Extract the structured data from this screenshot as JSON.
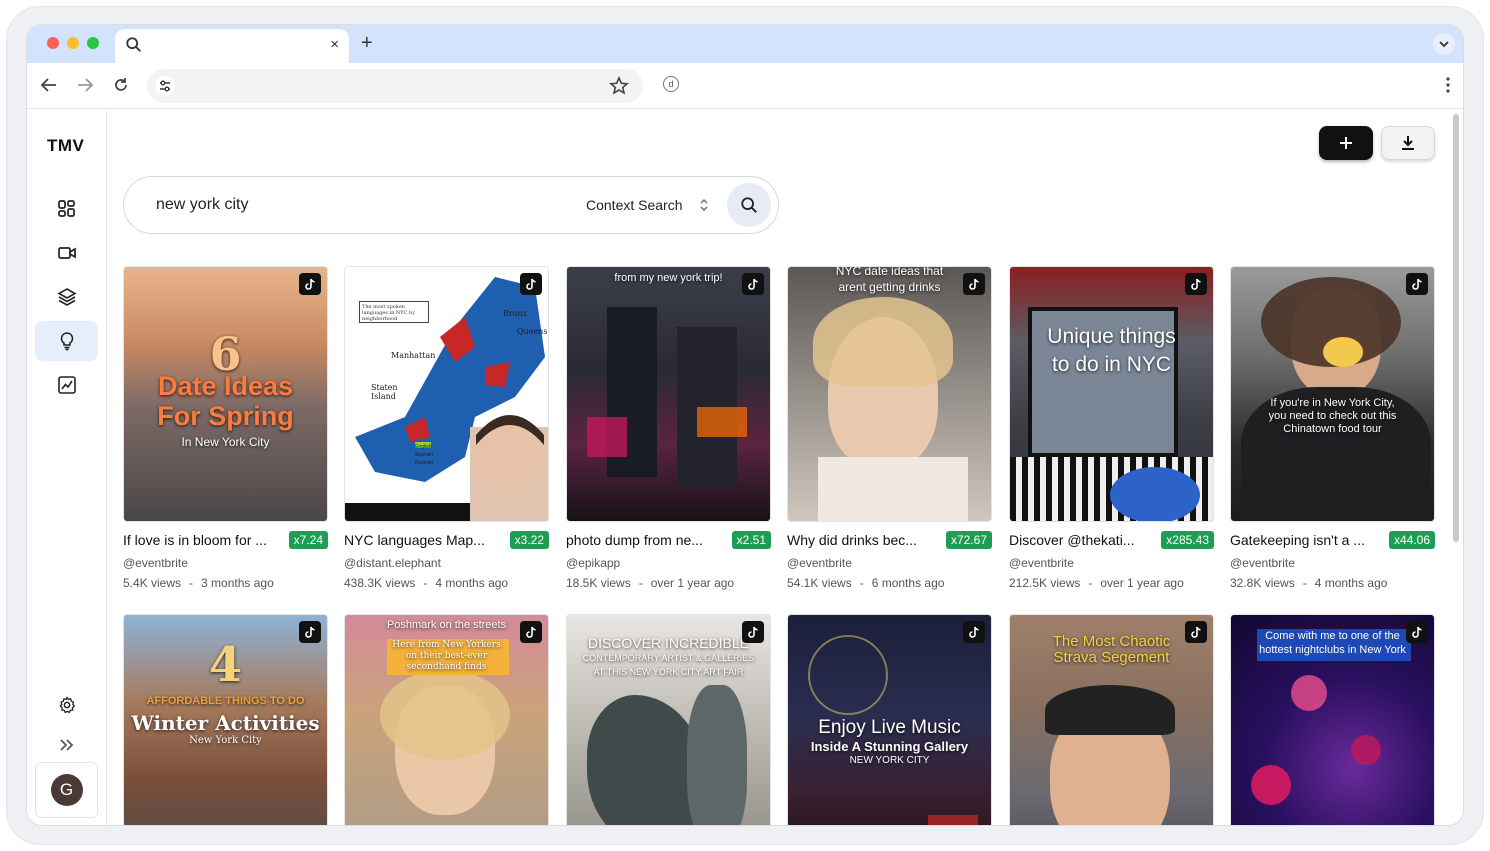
{
  "browser": {
    "tab_close": "×",
    "new_tab": "+",
    "extension_label": "d"
  },
  "app": {
    "logo": "TMV",
    "avatar_initial": "G"
  },
  "search": {
    "query": "new york city",
    "mode": "Context Search"
  },
  "videos": [
    {
      "title": "If love is in bloom for ...",
      "multiplier": "x7.24",
      "handle": "@eventbrite",
      "views": "5.4K views",
      "age": "3 months ago",
      "overlay": {
        "big": "6",
        "line1": "Date Ideas",
        "line2": "For Spring",
        "line3": "In New York City"
      }
    },
    {
      "title": "NYC languages Map...",
      "multiplier": "x3.22",
      "handle": "@distant.elephant",
      "views": "438.3K views",
      "age": "4 months ago",
      "overlay": {
        "line1": "The most spoken languages in NYC by neighborhood",
        "a": "Bronx",
        "b": "Queens",
        "c": "Manhattan",
        "d": "Staten Island",
        "l1": "English",
        "l2": "Spanish",
        "l3": "Russian"
      }
    },
    {
      "title": "photo dump from ne...",
      "multiplier": "x2.51",
      "handle": "@epikapp",
      "views": "18.5K views",
      "age": "over 1 year ago",
      "overlay": {
        "line1": "from my new york trip!"
      }
    },
    {
      "title": "Why did drinks bec...",
      "multiplier": "x72.67",
      "handle": "@eventbrite",
      "views": "54.1K views",
      "age": "6 months ago",
      "overlay": {
        "line1": "NYC date ideas that",
        "line2": "arent getting drinks"
      }
    },
    {
      "title": "Discover @thekati...",
      "multiplier": "x285.43",
      "handle": "@eventbrite",
      "views": "212.5K views",
      "age": "over 1 year ago",
      "overlay": {
        "line1": "Unique things",
        "line2": "to do in NYC"
      }
    },
    {
      "title": "Gatekeeping isn't a ...",
      "multiplier": "x44.06",
      "handle": "@eventbrite",
      "views": "32.8K views",
      "age": "4 months ago",
      "overlay": {
        "line1": "If you're in New York City,",
        "line2": "you need to check out this",
        "line3": "Chinatown food tour"
      }
    },
    {
      "title": "",
      "multiplier": "",
      "handle": "",
      "views": "",
      "age": "",
      "overlay": {
        "big": "4",
        "line1": "AFFORDABLE THINGS TO DO",
        "line2": "Winter Activities",
        "line3": "New York City"
      }
    },
    {
      "title": "",
      "multiplier": "",
      "handle": "",
      "views": "",
      "age": "",
      "overlay": {
        "line1": "Poshmark on the streets",
        "line2": "Here from New Yorkers",
        "line3": "on their best-ever",
        "line4": "secondhand finds"
      }
    },
    {
      "title": "",
      "multiplier": "",
      "handle": "",
      "views": "",
      "age": "",
      "overlay": {
        "line1": "DISCOVER INCREDIBLE",
        "line2": "CONTEMPORARY ARTIST & GALLERIES",
        "line3": "AT THIS NEW YORK CITY ART FAIR"
      }
    },
    {
      "title": "",
      "multiplier": "",
      "handle": "",
      "views": "",
      "age": "",
      "overlay": {
        "line1": "Enjoy Live Music",
        "line2": "Inside A Stunning Gallery",
        "line3": "NEW YORK CITY"
      }
    },
    {
      "title": "",
      "multiplier": "",
      "handle": "",
      "views": "",
      "age": "",
      "overlay": {
        "line1": "The Most Chaotic",
        "line2": "Strava Segement"
      }
    },
    {
      "title": "",
      "multiplier": "",
      "handle": "",
      "views": "",
      "age": "",
      "overlay": {
        "line1": "Come with me to one of the",
        "line2": "hottest nightclubs in New York"
      }
    }
  ],
  "meta_separator": "-",
  "colors": {
    "tab_strip": "#d3e3fd",
    "badge": "#1f9d55",
    "active_nav": "#e6eefb"
  }
}
